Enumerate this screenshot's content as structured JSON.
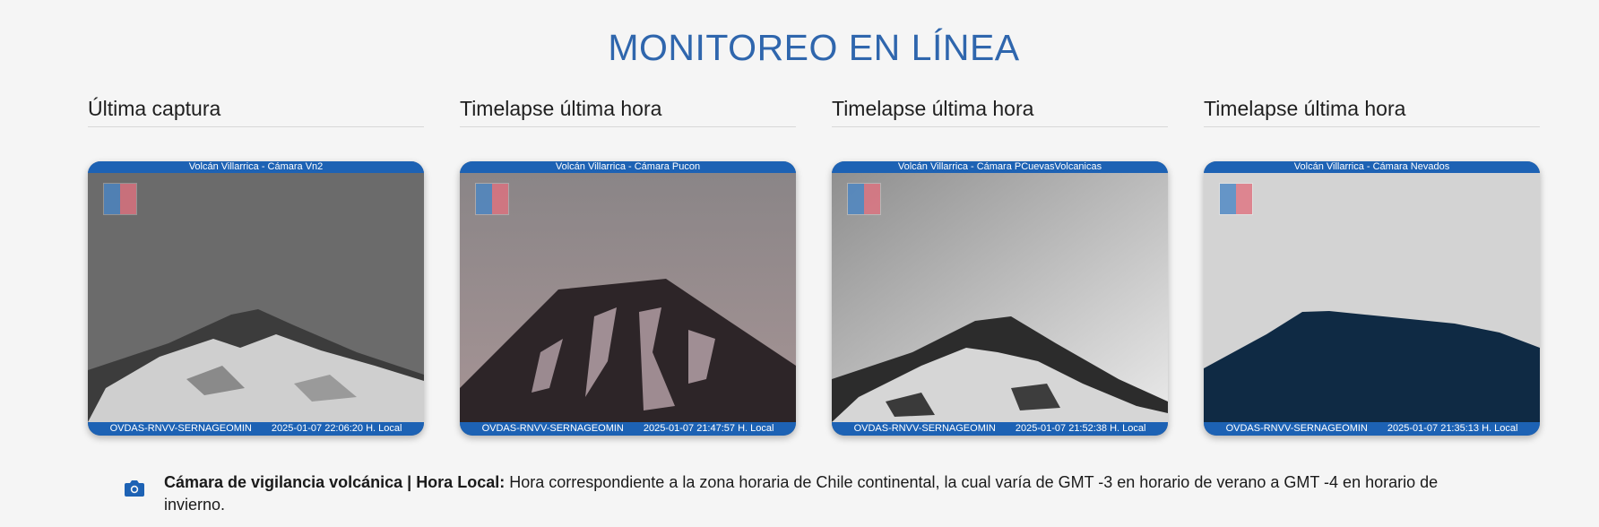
{
  "page": {
    "title": "MONITOREO EN LÍNEA"
  },
  "columns": [
    {
      "heading": "Última captura",
      "camera_label": "Volcán Villarrica - Cámara Vn2",
      "source": "OVDAS-RNVV-SERNAGEOMIN",
      "timestamp": "2025-01-07 22:06:20 H. Local"
    },
    {
      "heading": "Timelapse última hora",
      "camera_label": "Volcán Villarrica - Cámara Pucon",
      "source": "OVDAS-RNVV-SERNAGEOMIN",
      "timestamp": "2025-01-07 21:47:57 H. Local"
    },
    {
      "heading": "Timelapse última hora",
      "camera_label": "Volcán Villarrica - Cámara PCuevasVolcanicas",
      "source": "OVDAS-RNVV-SERNAGEOMIN",
      "timestamp": "2025-01-07 21:52:38 H. Local"
    },
    {
      "heading": "Timelapse última hora",
      "camera_label": "Volcán Villarrica - Cámara Nevados",
      "source": "OVDAS-RNVV-SERNAGEOMIN",
      "timestamp": "2025-01-07 21:35:13 H. Local"
    }
  ],
  "note": {
    "icon": "camera-icon",
    "bold_label": "Cámara de vigilancia volcánica",
    "separator": " | ",
    "bold_label2": "Hora Local:",
    "text": " Hora correspondiente a la zona horaria de Chile continental,  la cual varía de GMT -3 en horario de verano a GMT -4 en horario de invierno."
  },
  "colors": {
    "accent": "#2f66ad",
    "banner": "#1d62b4",
    "background": "#f5f5f5"
  }
}
